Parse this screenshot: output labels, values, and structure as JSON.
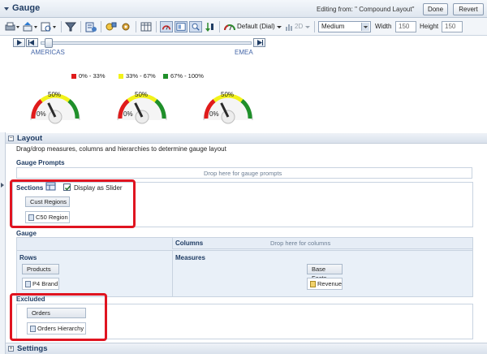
{
  "titlebar": {
    "title": "Gauge",
    "editing": "Editing from: \" Compound Layout\"",
    "done_label": "Done",
    "revert_label": "Revert"
  },
  "toolbar": {
    "gauge_type": "Default (Dial)",
    "size": "Medium",
    "width_label": "Width",
    "width_value": "150",
    "height_label": "Height",
    "height_value": "150",
    "twod_label": "2D"
  },
  "slider": {
    "labels": [
      "AMERICAS",
      "EMEA"
    ],
    "position": 0.02
  },
  "legend": [
    {
      "label": "0% - 33%",
      "color": "#e01b1b"
    },
    {
      "label": "33% - 67%",
      "color": "#f2f21a"
    },
    {
      "label": "67% - 100%",
      "color": "#1f8f2a"
    }
  ],
  "gauges": [
    {
      "min_label": "0%",
      "value_label": "50%",
      "value": 0.5
    },
    {
      "min_label": "0%",
      "value_label": "50%",
      "value": 0.5
    },
    {
      "min_label": "0%",
      "value_label": "50%",
      "value": 0.5
    }
  ],
  "layout": {
    "header": "Layout",
    "description": "Drag/drop measures, columns and hierarchies to determine gauge layout",
    "gauge_prompts": {
      "title": "Gauge Prompts",
      "drop_text": "Drop here for gauge prompts"
    },
    "sections": {
      "title": "Sections",
      "slider_checkbox_label": "Display as Slider",
      "slider_checked": true,
      "chip_head": "Cust Regions",
      "chip": "C50 Region"
    },
    "gauge": {
      "title": "Gauge",
      "columns_label": "Columns",
      "columns_drop_text": "Drop here for columns",
      "rows_label": "Rows",
      "rows_chip_head": "Products",
      "rows_chip": "P4 Brand",
      "measures_label": "Measures",
      "measures_chip_head": "Base Facts",
      "measures_chip": "Revenue"
    },
    "excluded": {
      "title": "Excluded",
      "chip_head": "Orders",
      "chip": "Orders Hierarchy"
    }
  },
  "settings": {
    "header": "Settings"
  }
}
